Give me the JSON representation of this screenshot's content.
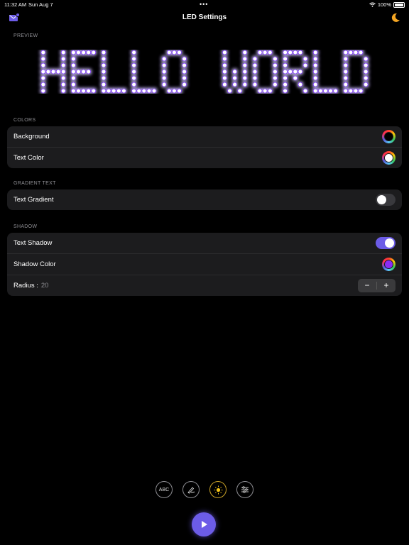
{
  "status_bar": {
    "time": "11:32 AM",
    "date": "Sun Aug 7",
    "battery": "100%"
  },
  "nav": {
    "title": "LED Settings",
    "left_icon": "envelope-icon",
    "right_icon": "moon-icon"
  },
  "preview": {
    "label": "PREVIEW",
    "text": "HELLO WORLD",
    "text_color": "#ffffff",
    "glow_color": "#7b2cff"
  },
  "colors_section": {
    "header": "COLORS",
    "rows": [
      {
        "label": "Background",
        "swatch": "#000000"
      },
      {
        "label": "Text Color",
        "swatch": "#ffffff"
      }
    ]
  },
  "gradient_section": {
    "header": "GRADIENT TEXT",
    "rows": [
      {
        "label": "Text Gradient",
        "enabled": false
      }
    ]
  },
  "shadow_section": {
    "header": "SHADOW",
    "text_shadow": {
      "label": "Text Shadow",
      "enabled": true
    },
    "shadow_color": {
      "label": "Shadow Color",
      "swatch": "#8b2cf5"
    },
    "radius": {
      "label": "Radius :",
      "value": "20",
      "minus": "−",
      "plus": "+"
    }
  },
  "toolbar": {
    "text_tool": "ABC",
    "items": [
      "text-tool",
      "draw-tool",
      "brightness-tool",
      "settings-tool"
    ],
    "active": "brightness-tool"
  },
  "accent_color": "#6c5ce7",
  "active_tool_color": "#c9a227"
}
